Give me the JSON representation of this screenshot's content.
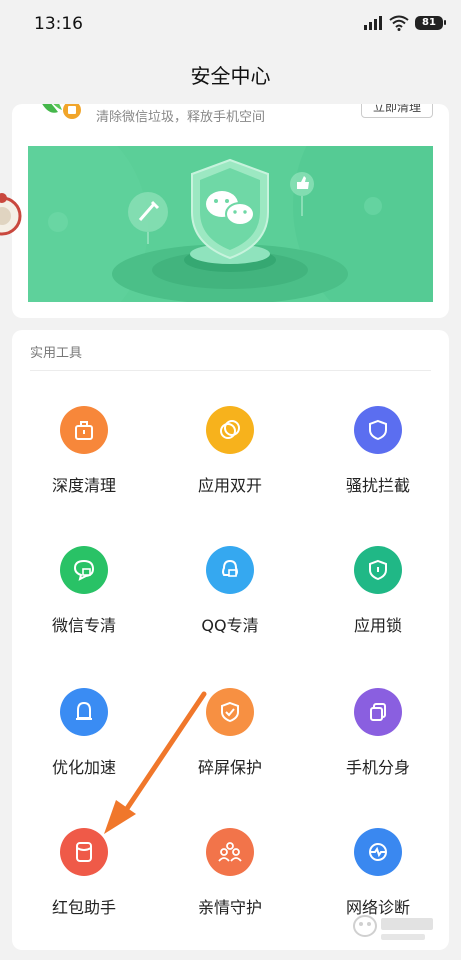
{
  "status_bar": {
    "time": "13:16",
    "battery": "81"
  },
  "header": {
    "title": "安全中心"
  },
  "cleanup_card": {
    "subtitle": "清除微信垃圾，释放手机空间",
    "button_label": "立即清理"
  },
  "tools": {
    "section_title": "实用工具",
    "items": [
      {
        "label": "深度清理",
        "icon": "briefcase-icon",
        "color": "#f7873a"
      },
      {
        "label": "应用双开",
        "icon": "dual-circle-icon",
        "color": "#f7b21c"
      },
      {
        "label": "骚扰拦截",
        "icon": "shield-icon",
        "color": "#5b6ef0"
      },
      {
        "label": "微信专清",
        "icon": "wechat-clean-icon",
        "color": "#29c266"
      },
      {
        "label": "QQ专清",
        "icon": "qq-clean-icon",
        "color": "#35a8f0"
      },
      {
        "label": "应用锁",
        "icon": "lock-shield-icon",
        "color": "#20b886"
      },
      {
        "label": "优化加速",
        "icon": "bell-icon",
        "color": "#3a8cf3"
      },
      {
        "label": "碎屏保护",
        "icon": "screen-shield-icon",
        "color": "#f79042"
      },
      {
        "label": "手机分身",
        "icon": "copy-icon",
        "color": "#8a5fe0"
      },
      {
        "label": "红包助手",
        "icon": "red-envelope-icon",
        "color": "#ef5a48"
      },
      {
        "label": "亲情守护",
        "icon": "family-icon",
        "color": "#f2744a"
      },
      {
        "label": "网络诊断",
        "icon": "network-icon",
        "color": "#3a88f0"
      }
    ]
  },
  "colors": {
    "accent_green": "#5bcf98",
    "arrow": "#f0772b"
  }
}
